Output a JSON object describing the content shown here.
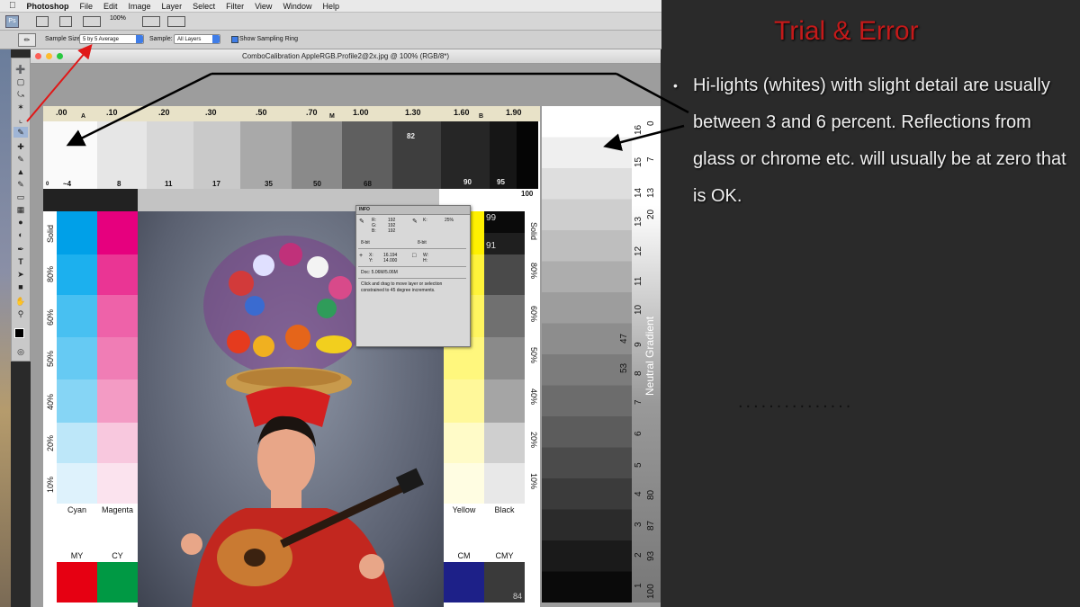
{
  "menubar": {
    "items": [
      "Photoshop",
      "File",
      "Edit",
      "Image",
      "Layer",
      "Select",
      "Filter",
      "View",
      "Window",
      "Help"
    ]
  },
  "appbar": {
    "zoom": "100%"
  },
  "options_bar": {
    "sample_size_label": "Sample Size:",
    "sample_size_value": "5 by 5 Average",
    "sample_label": "Sample:",
    "sample_value": "All Layers",
    "show_ring_label": "Show Sampling Ring"
  },
  "document": {
    "title": "ComboCalibration AppleRGB.Profile2@2x.jpg @ 100% (RGB/8*)"
  },
  "density_strip": {
    "density_labels": [
      ".00",
      ".10",
      ".20",
      ".30",
      ".50",
      ".70",
      "1.00",
      "1.30",
      "1.60",
      "1.90"
    ],
    "density_letters": [
      "A",
      "M",
      "B"
    ],
    "percent_labels": [
      "0",
      "~4",
      "8",
      "11",
      "17",
      "35",
      "50",
      "68",
      "82",
      "90",
      "95",
      "100"
    ]
  },
  "color_patches": {
    "left_percent_labels": [
      "Solid",
      "80%",
      "60%",
      "50%",
      "40%",
      "20%",
      "10%"
    ],
    "right_percent_labels": [
      "Solid",
      "80%",
      "60%",
      "50%",
      "40%",
      "20%",
      "10%"
    ],
    "cyan_label": "Cyan",
    "magenta_label": "Magenta",
    "yellow_label": "Yellow",
    "black_label": "Black",
    "my_label": "MY",
    "cy_label": "CY",
    "cm_label": "CM",
    "cmy_label": "CMY",
    "black_top_values": [
      "99",
      "91"
    ],
    "cmy_value": "84"
  },
  "neutral_gradient": {
    "label": "Neutral Gradient",
    "steps": [
      "16",
      "15",
      "14",
      "13",
      "12",
      "11",
      "10",
      "9",
      "8",
      "7",
      "6",
      "5",
      "4",
      "3",
      "2",
      "1"
    ],
    "values": [
      "0",
      "7",
      "13",
      "20",
      "47",
      "53",
      "80",
      "87",
      "93",
      "100"
    ]
  },
  "info_panel": {
    "title": "INFO",
    "r_label": "R:",
    "r_value": "192",
    "g_label": "G:",
    "g_value": "192",
    "b_label": "B:",
    "b_value": "192",
    "k_label": "K:",
    "k_value": "25%",
    "bit_left": "8-bit",
    "bit_right": "8-bit",
    "x_label": "X:",
    "x_value": "16.194",
    "y_label": "Y:",
    "y_value": "14.000",
    "w_label": "W:",
    "h_label": "H:",
    "doc": "Doc: 5.06M/5.06M",
    "hint": "Click and drag to move layer or selection constrained to 45 degree increments."
  },
  "slide": {
    "title": "Trial & Error",
    "bullet": "Hi-lights (whites) with slight detail are usually between 3 and 6 percent. Reflections from glass or chrome etc. will usually be at zero that is OK.",
    "dots": "..............."
  },
  "colors": {
    "title_red": "#c41a1a",
    "cyan": "#00a0e8",
    "magenta": "#e6007e",
    "yellow": "#fff000",
    "red": "#e60012",
    "green": "#009944",
    "blue": "#1d2088"
  }
}
